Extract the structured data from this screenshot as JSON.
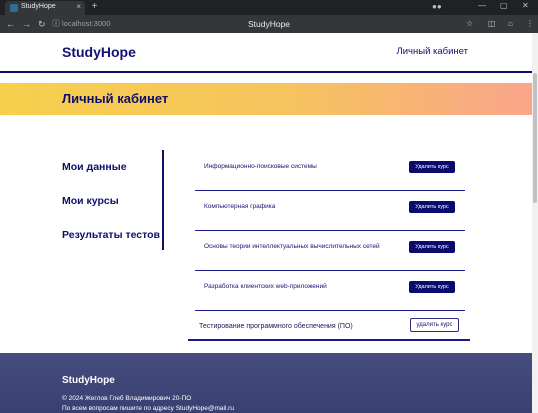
{
  "browser": {
    "tab_title": "StudyHope",
    "tab_close": "×",
    "new_tab": "+",
    "url": "localhost:3000",
    "window_title": "StudyHope",
    "icons": {
      "back": "←",
      "forward": "→",
      "reload": "↻",
      "info": "ⓘ",
      "home": "⌂",
      "extensions": "◫",
      "bookmark": "☆",
      "menu": "⋮",
      "minimize": "—",
      "maximize": "▢",
      "close": "✕"
    }
  },
  "header": {
    "logo": "StudyHope",
    "account_link": "Личный кабинет"
  },
  "banner": {
    "title": "Личный кабинет"
  },
  "sidebar": {
    "items": [
      {
        "label": "Мои данные"
      },
      {
        "label": "Мои курсы"
      },
      {
        "label": "Результаты тестов"
      }
    ]
  },
  "courses": [
    {
      "name": "Информационно-поисковые системы",
      "button": "Удалить курс"
    },
    {
      "name": "Компьютерная графика",
      "button": "Удалить курс"
    },
    {
      "name": "Основы теории интеллектуальных вычислительных сетей",
      "button": "Удалить курс"
    },
    {
      "name": "Разработка клиентских web-приложений",
      "button": "Удалить курс"
    },
    {
      "name": "Тестирование программного обеспечения (ПО)",
      "button": "удалить курс"
    }
  ],
  "footer": {
    "logo": "StudyHope",
    "copyright": "© 2024 Жеглов Глеб Владимирович 20-ПО",
    "contact": "По всем вопросам пишите по адресу StudyHope@mail.ru"
  },
  "colors": {
    "primary": "#0f0f6b",
    "banner_start": "#f6d04d",
    "banner_end": "#f9a58b",
    "footer": "#474c7f"
  }
}
